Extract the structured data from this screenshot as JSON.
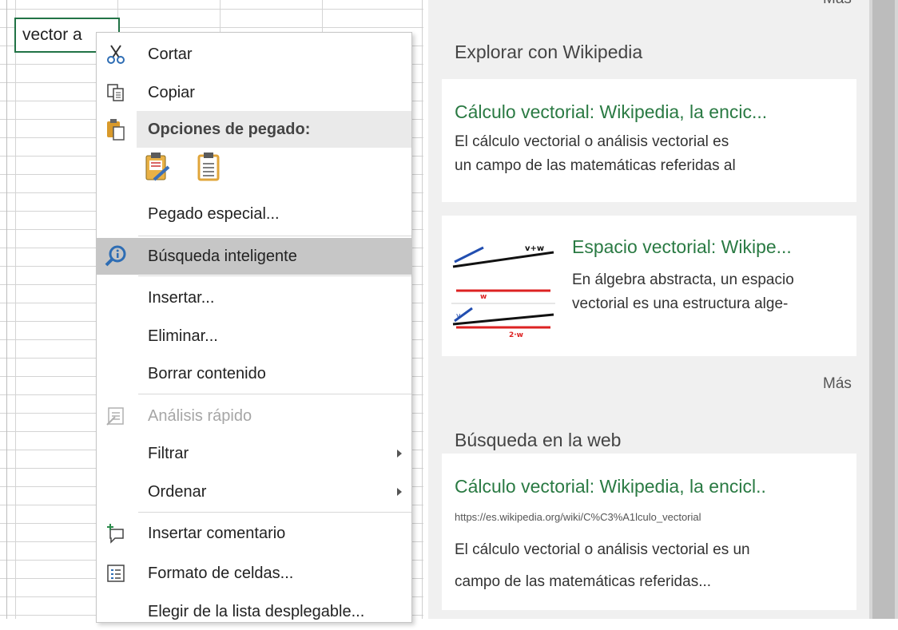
{
  "sheet": {
    "active_cell_text": "vector a"
  },
  "menu": {
    "cut": "Cortar",
    "copy": "Copiar",
    "paste_options": "Opciones de pegado:",
    "paste_special": "Pegado especial...",
    "smart_lookup": "Búsqueda inteligente",
    "insert": "Insertar...",
    "delete": "Eliminar...",
    "clear_contents": "Borrar contenido",
    "quick_analysis": "Análisis rápido",
    "filter": "Filtrar",
    "sort": "Ordenar",
    "insert_comment": "Insertar comentario",
    "format_cells": "Formato de celdas...",
    "pick_from_list": "Elegir de la lista desplegable..."
  },
  "pane": {
    "more_top": "Más",
    "explore_title": "Explorar con Wikipedia",
    "card1": {
      "title": "Cálculo vectorial: Wikipedia, la encic...",
      "line1": "El cálculo vectorial o análisis vectorial es",
      "line2": "un campo de las matemáticas referidas al"
    },
    "card2": {
      "title": "Espacio vectorial: Wikipe...",
      "line1": "En álgebra abstracta, un espacio",
      "line2": "vectorial es una estructura alge-",
      "thumb_label_top": "v+w",
      "thumb_label_w": "w",
      "thumb_label_v": "v",
      "thumb_label_2w": "2·w"
    },
    "more_mid": "Más",
    "web_title": "Búsqueda en la web",
    "web_card": {
      "title": "Cálculo vectorial: Wikipedia, la encicl..",
      "url": "https://es.wikipedia.org/wiki/C%C3%A1lculo_vectorial",
      "line1": "El cálculo vectorial o análisis vectorial es un",
      "line2": "campo de las matemáticas referidas..."
    }
  },
  "colors": {
    "accent_green": "#2a7a43",
    "cell_border": "#217346",
    "highlight": "#c6c6c6"
  }
}
